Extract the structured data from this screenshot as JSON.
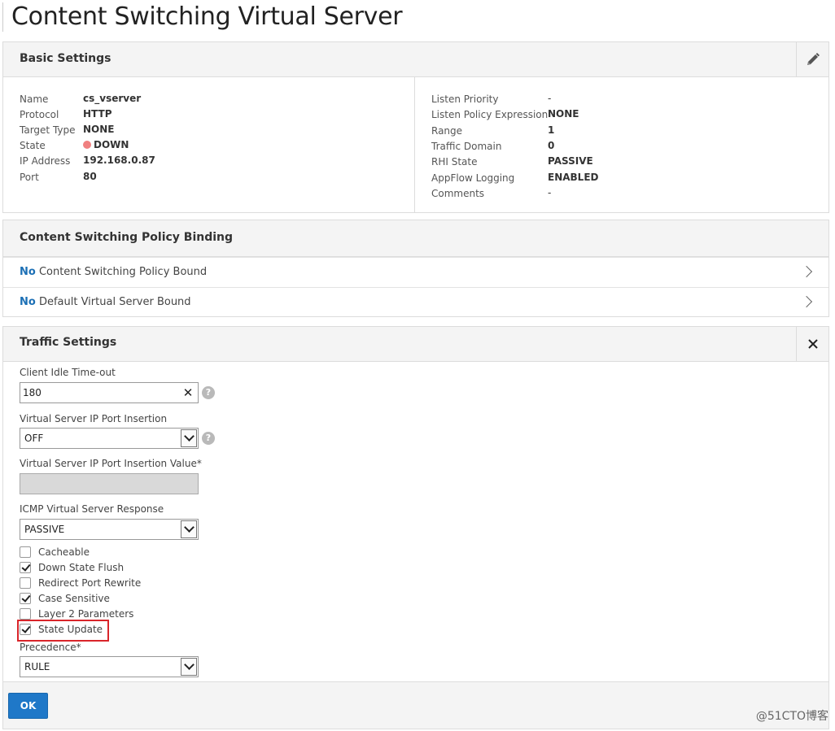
{
  "page": {
    "title": "Content Switching Virtual Server"
  },
  "basic": {
    "title": "Basic Settings",
    "edit_icon": "pencil-icon",
    "left": [
      {
        "label": "Name",
        "value": "cs_vserver"
      },
      {
        "label": "Protocol",
        "value": "HTTP"
      },
      {
        "label": "Target Type",
        "value": "NONE"
      },
      {
        "label": "State",
        "value": "DOWN"
      },
      {
        "label": "IP Address",
        "value": "192.168.0.87"
      },
      {
        "label": "Port",
        "value": "80"
      }
    ],
    "right": [
      {
        "label": "Listen Priority",
        "value": "-"
      },
      {
        "label": "Listen Policy Expression",
        "value": "NONE"
      },
      {
        "label": "Range",
        "value": "1"
      },
      {
        "label": "Traffic Domain",
        "value": "0"
      },
      {
        "label": "RHI State",
        "value": "PASSIVE"
      },
      {
        "label": "AppFlow Logging",
        "value": "ENABLED"
      },
      {
        "label": "Comments",
        "value": "-"
      }
    ],
    "state_color": "#f08080"
  },
  "policy": {
    "title": "Content Switching Policy Binding",
    "rows": [
      {
        "prefix": "No",
        "text": " Content Switching Policy Bound"
      },
      {
        "prefix": "No",
        "text": " Default Virtual Server Bound"
      }
    ]
  },
  "traffic": {
    "title": "Traffic Settings",
    "close_icon": "close-icon",
    "idle_label": "Client Idle Time-out",
    "idle_value": "180",
    "clear_glyph": "✕",
    "help_glyph": "?",
    "port_insertion_label": "Virtual Server IP Port Insertion",
    "port_insertion_value": "OFF",
    "port_insertion_value_label": "Virtual Server IP Port Insertion Value*",
    "icmp_label": "ICMP Virtual Server Response",
    "icmp_value": "PASSIVE",
    "checkboxes": [
      {
        "label": "Cacheable",
        "checked": false
      },
      {
        "label": "Down State Flush",
        "checked": true
      },
      {
        "label": "Redirect Port Rewrite",
        "checked": false
      },
      {
        "label": "Case Sensitive",
        "checked": true
      },
      {
        "label": "Layer 2 Parameters",
        "checked": false
      },
      {
        "label": "State Update",
        "checked": true
      }
    ],
    "precedence_label": "Precedence*",
    "precedence_value": "RULE",
    "ok_label": "OK",
    "accent": "#1f78c8"
  },
  "watermark": "@51CTO博客"
}
